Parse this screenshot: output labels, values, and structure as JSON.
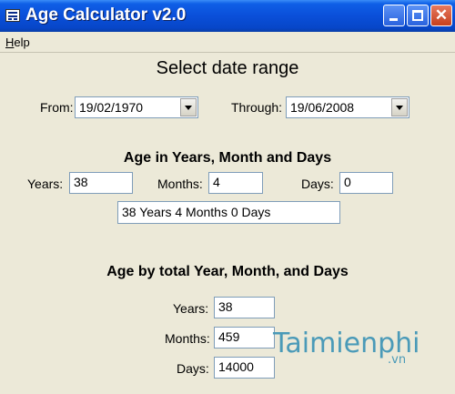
{
  "window": {
    "title": "Age Calculator v2.0",
    "close_glyph": "✕"
  },
  "menu": {
    "help_first": "H",
    "help_rest": "elp"
  },
  "date_range": {
    "heading": "Select date range",
    "from_label": "From:",
    "from_value": "19/02/1970",
    "through_label": "Through:",
    "through_value": "19/06/2008"
  },
  "age": {
    "heading": "Age in Years, Month and Days",
    "years_label": "Years:",
    "years_value": "38",
    "months_label": "Months:",
    "months_value": "4",
    "days_label": "Days:",
    "days_value": "0",
    "summary": "38 Years 4 Months 0 Days"
  },
  "totals": {
    "heading": "Age by total Year, Month, and Days",
    "years_label": "Years:",
    "years_value": "38",
    "months_label": "Months:",
    "months_value": "459",
    "days_label": "Days:",
    "days_value": "14000"
  },
  "watermark": {
    "brand": "Taimienphi",
    "suffix": ".vn"
  }
}
